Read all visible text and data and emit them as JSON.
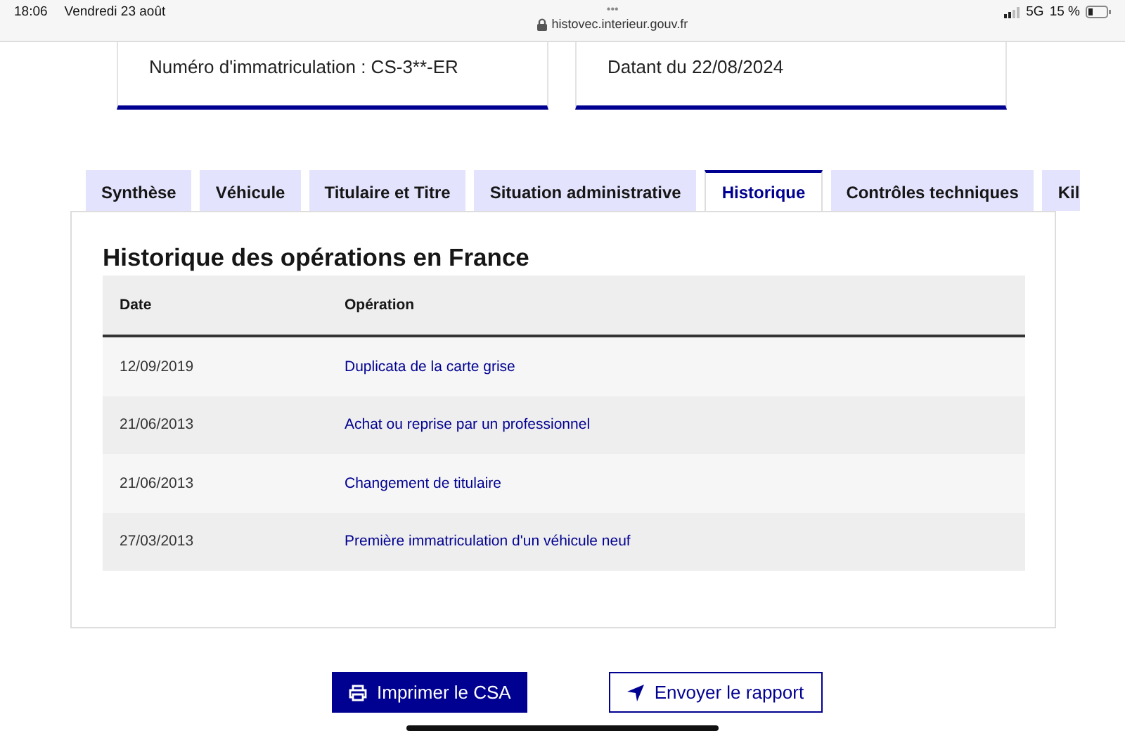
{
  "status_bar": {
    "time": "18:06",
    "date": "Vendredi 23 août",
    "menu_dots": "•••",
    "url": "histovec.interieur.gouv.fr",
    "network": "5G",
    "battery": "15 %"
  },
  "cards": [
    {
      "text": "Numéro d'immatriculation : CS-3**-ER"
    },
    {
      "text": "Datant du 22/08/2024"
    }
  ],
  "tabs": [
    {
      "label": "Synthèse",
      "selected": false
    },
    {
      "label": "Véhicule",
      "selected": false
    },
    {
      "label": "Titulaire et Titre",
      "selected": false
    },
    {
      "label": "Situation administrative",
      "selected": false
    },
    {
      "label": "Historique",
      "selected": true
    },
    {
      "label": "Contrôles techniques",
      "selected": false
    },
    {
      "label": "Kil",
      "selected": false
    }
  ],
  "section_title": "Historique des opérations en France",
  "table": {
    "columns": [
      "Date",
      "Opération"
    ],
    "rows": [
      [
        "12/09/2019",
        "Duplicata de la carte grise"
      ],
      [
        "21/06/2013",
        "Achat ou reprise par un professionnel"
      ],
      [
        "21/06/2013",
        "Changement de titulaire"
      ],
      [
        "27/03/2013",
        "Première immatriculation d'un véhicule neuf"
      ]
    ]
  },
  "buttons": [
    {
      "kind": "primary",
      "label": "Imprimer le CSA"
    },
    {
      "kind": "secondary",
      "label": "Envoyer le rapport"
    }
  ]
}
